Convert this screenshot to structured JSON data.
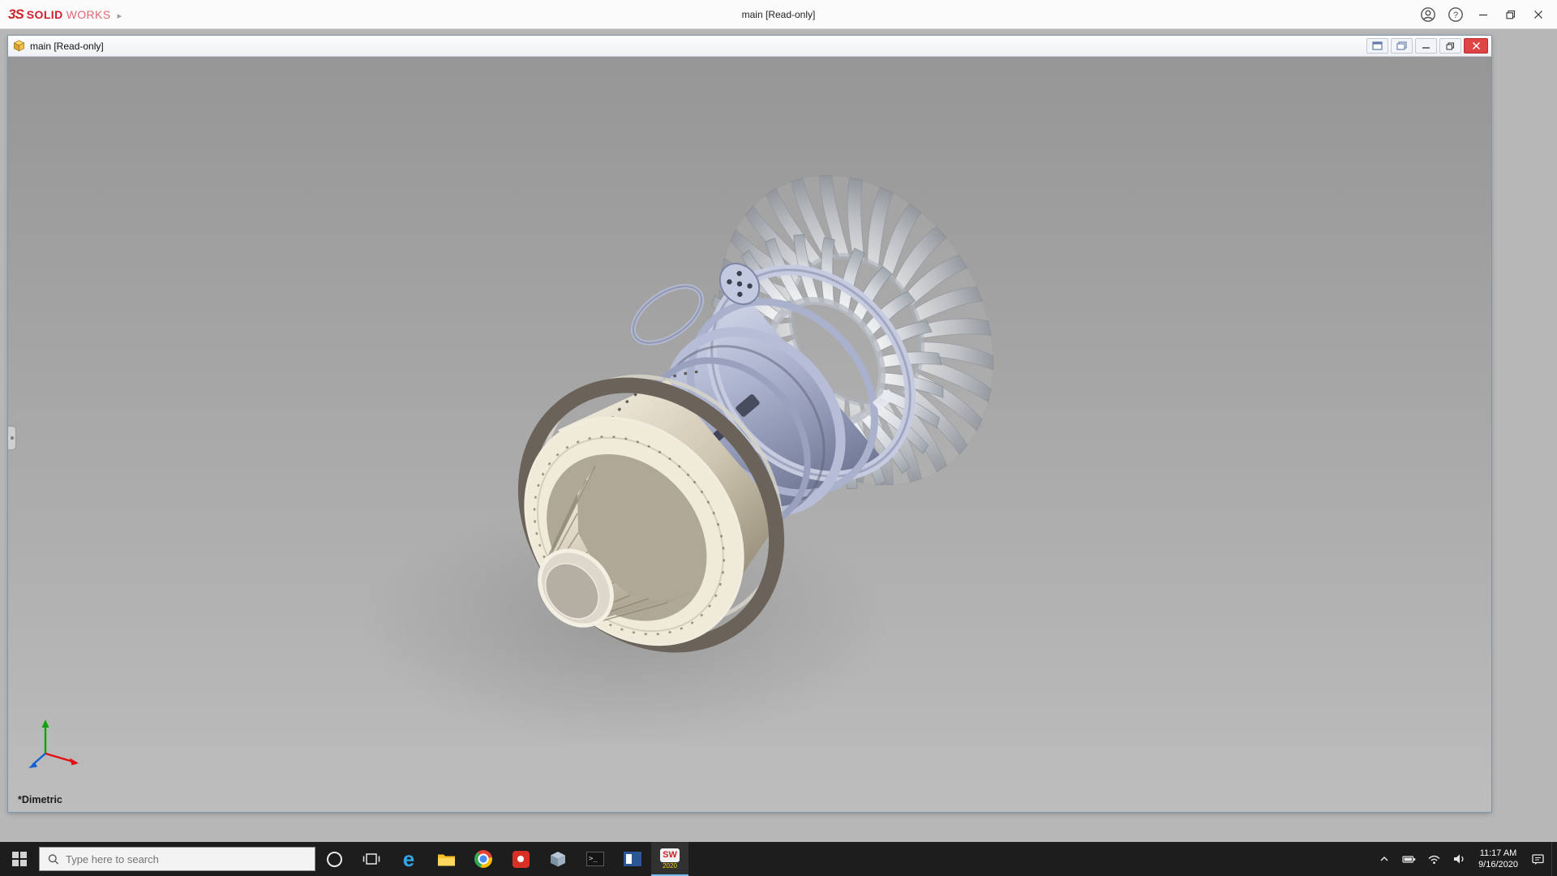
{
  "app": {
    "logo_mark": "3S",
    "brand_solid": "SOLID",
    "brand_works": "WORKS",
    "title": "main [Read-only]"
  },
  "doc_window": {
    "title": "main [Read-only]",
    "view_orientation": "*Dimetric"
  },
  "taskbar": {
    "search_placeholder": "Type here to search",
    "apps": [
      {
        "name": "cortana"
      },
      {
        "name": "task-view"
      },
      {
        "name": "edge"
      },
      {
        "name": "file-explorer"
      },
      {
        "name": "chrome"
      },
      {
        "name": "red-app"
      },
      {
        "name": "cube-app"
      },
      {
        "name": "command-prompt"
      },
      {
        "name": "blue-window-app"
      },
      {
        "name": "solidworks-2020",
        "label": "SW",
        "badge": "2020",
        "active": true
      }
    ],
    "tray": {
      "time": "11:17 AM",
      "date": "9/16/2020"
    }
  },
  "icons": {
    "brand_arrow": "▸",
    "edge_letter": "e",
    "terminal_glyph": ">_",
    "help_glyph": "?"
  },
  "colors": {
    "brand_red": "#d2232a",
    "close_red": "#e04343",
    "taskbar_bg": "#1d1d1d",
    "viewport_top": "#969696",
    "viewport_bottom": "#bdbdbd",
    "engine_cream": "#ded6c4",
    "engine_steel_blue": "#a9b1cc",
    "engine_blade_silver": "#d3d6da",
    "engine_dark_ring": "#6b6359"
  }
}
